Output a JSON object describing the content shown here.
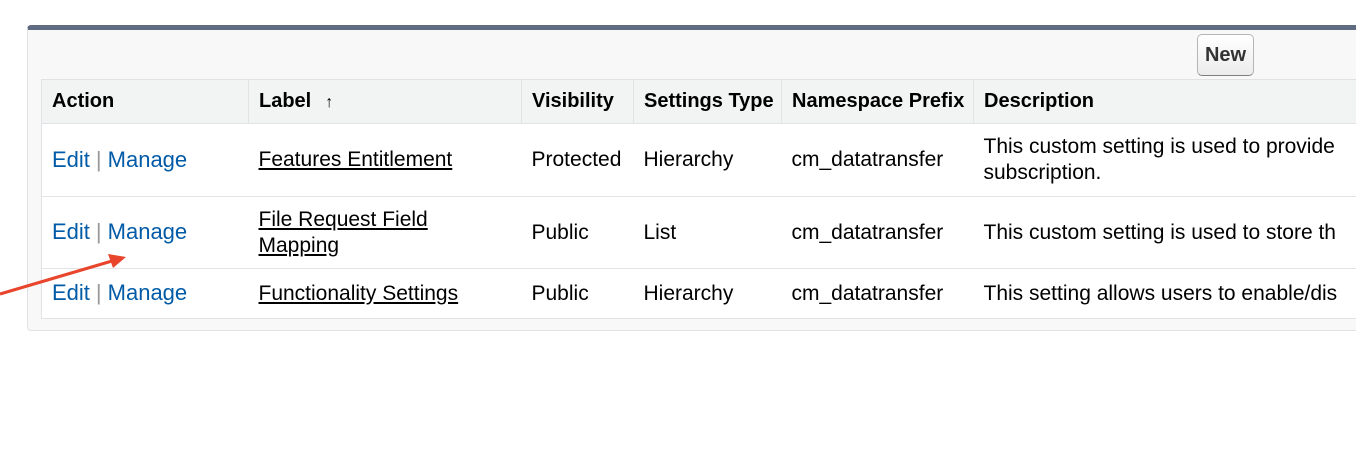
{
  "toolbar": {
    "new_label": "New"
  },
  "table": {
    "headers": {
      "action": "Action",
      "label": "Label",
      "visibility": "Visibility",
      "settings_type": "Settings Type",
      "namespace_prefix": "Namespace Prefix",
      "description": "Description"
    },
    "sort_indicator": "↑",
    "separator": "|",
    "rows": [
      {
        "edit": "Edit",
        "manage": "Manage",
        "label": "Features Entitlement",
        "visibility": "Protected",
        "settings_type": "Hierarchy",
        "namespace_prefix": "cm_datatransfer",
        "description": "This custom setting is used to provide subscription."
      },
      {
        "edit": "Edit",
        "manage": "Manage",
        "label": "File Request Field Mapping",
        "visibility": "Public",
        "settings_type": "List",
        "namespace_prefix": "cm_datatransfer",
        "description": "This custom setting is used to store th"
      },
      {
        "edit": "Edit",
        "manage": "Manage",
        "label": "Functionality Settings",
        "visibility": "Public",
        "settings_type": "Hierarchy",
        "namespace_prefix": "cm_datatransfer",
        "description": "This setting allows users to enable/dis"
      }
    ]
  },
  "annotation": {
    "arrow_color": "#e8452c"
  },
  "icons": {
    "row_icon": "custom-setting-icon",
    "sort": "sort-ascending-icon"
  }
}
